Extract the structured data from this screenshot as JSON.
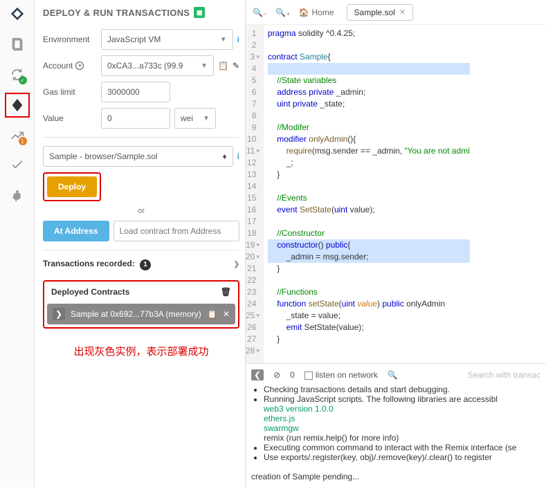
{
  "panel": {
    "title": "DEPLOY & RUN TRANSACTIONS",
    "env_label": "Environment",
    "env_value": "JavaScript VM",
    "account_label": "Account",
    "account_value": "0xCA3...a733c (99.9",
    "gas_label": "Gas limit",
    "gas_value": "3000000",
    "value_label": "Value",
    "value_amount": "0",
    "value_unit": "wei",
    "contract_selected": "Sample - browser/Sample.sol",
    "deploy_btn": "Deploy",
    "or_text": "or",
    "ataddress_btn": "At Address",
    "ataddress_placeholder": "Load contract from Address",
    "tx_recorded_label": "Transactions recorded:",
    "tx_recorded_count": "1",
    "deployed_title": "Deployed Contracts",
    "instance_label": "Sample at 0x692...77b3A (memory)",
    "annotation": "出现灰色实例，表示部署成功"
  },
  "toolbar": {
    "home": "Home",
    "tab1": "Sample.sol"
  },
  "code_lines": [
    {
      "n": 1,
      "f": "",
      "h": "<span class='kw'>pragma</span> solidity ^0.4.25;"
    },
    {
      "n": 2,
      "f": "",
      "h": ""
    },
    {
      "n": 3,
      "f": "▾",
      "h": "<span class='kw'>contract</span> <span class='ty'>Sample</span>{"
    },
    {
      "n": 4,
      "f": "",
      "h": "",
      "hl": true
    },
    {
      "n": 5,
      "f": "",
      "h": "    <span class='cm'>//State variables</span>"
    },
    {
      "n": 6,
      "f": "",
      "h": "    <span class='kw'>address private</span> _admin;"
    },
    {
      "n": 7,
      "f": "",
      "h": "    <span class='kw'>uint private</span> _state;"
    },
    {
      "n": 8,
      "f": "",
      "h": ""
    },
    {
      "n": 9,
      "f": "",
      "h": "    <span class='cm'>//Modifer</span>"
    },
    {
      "n": 10,
      "f": "",
      "h": "    <span class='kw'>modifier</span> <span class='fn'>onlyAdmin</span>(){"
    },
    {
      "n": 11,
      "f": "▾",
      "h": "        <span class='fn'>require</span>(msg.sender == _admin, <span class='str'>\"You are not admi</span>"
    },
    {
      "n": 12,
      "f": "",
      "h": "        _;"
    },
    {
      "n": 13,
      "f": "",
      "h": "    }"
    },
    {
      "n": 14,
      "f": "",
      "h": ""
    },
    {
      "n": 15,
      "f": "",
      "h": "    <span class='cm'>//Events</span>"
    },
    {
      "n": 16,
      "f": "",
      "h": "    <span class='kw'>event</span> <span class='fn'>SetState</span>(<span class='kw'>uint</span> value);"
    },
    {
      "n": 17,
      "f": "",
      "h": ""
    },
    {
      "n": 18,
      "f": "",
      "h": "    <span class='cm'>//Constructor</span>"
    },
    {
      "n": 19,
      "f": "▾",
      "h": "    <span class='kw'>constructor</span>() <span class='kw'>public</span>{",
      "hl": true
    },
    {
      "n": 20,
      "f": "▾",
      "h": "        _admin = msg.sender;",
      "hl": true
    },
    {
      "n": 21,
      "f": "",
      "h": "    }"
    },
    {
      "n": 22,
      "f": "",
      "h": ""
    },
    {
      "n": 23,
      "f": "",
      "h": "    <span class='cm'>//Functions</span>"
    },
    {
      "n": 24,
      "f": "",
      "h": "    <span class='kw'>function</span> <span class='fn'>setState</span>(<span class='kw'>uint</span> <span class='it'>value</span>) <span class='kw'>public</span> onlyAdmin"
    },
    {
      "n": 25,
      "f": "▾",
      "h": "        _state = value;"
    },
    {
      "n": 26,
      "f": "",
      "h": "        <span class='kw'>emit</span> SetState(value);"
    },
    {
      "n": 27,
      "f": "",
      "h": "    }"
    },
    {
      "n": 28,
      "f": "▾",
      "h": ""
    }
  ],
  "term": {
    "zero": "0",
    "listen": "listen on network",
    "search_placeholder": "Search with transac",
    "l1": "Checking transactions details and start debugging.",
    "l2": "Running JavaScript scripts. The following libraries are accessibl",
    "lib1": "web3 version 1.0.0",
    "lib2": "ethers.js",
    "lib3": "swarmgw",
    "lib4": "remix (run remix.help() for more info)",
    "l3": "Executing common command to interact with the Remix interface (se",
    "l4": "Use exports/.register(key, obj)/.remove(key)/.clear() to register",
    "pending": "creation of Sample pending..."
  }
}
